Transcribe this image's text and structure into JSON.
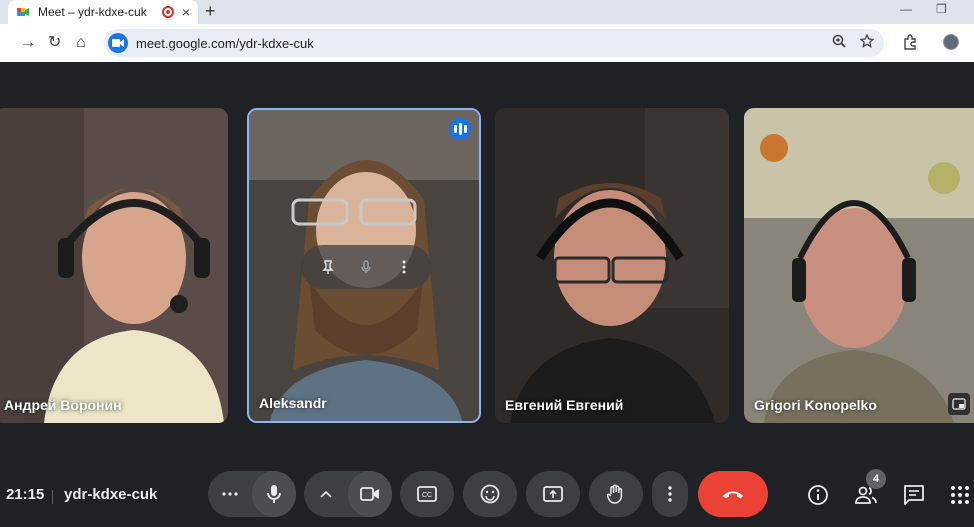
{
  "browser": {
    "tab_title": "Meet – ydr-kdxe-cuk",
    "tab_close": "×",
    "new_tab": "+",
    "minimize": "—",
    "maximize": "❐",
    "back": "→",
    "reload": "↻",
    "home": "⌂",
    "url": "meet.google.com/ydr-kdxe-cuk"
  },
  "participants": [
    {
      "name": "Андрей Воронин",
      "bg": "#5a4c48"
    },
    {
      "name": "Aleksandr",
      "bg": "#4a4440",
      "speaking": true,
      "active": true
    },
    {
      "name": "Евгений Евгений",
      "bg": "#2e2b29"
    },
    {
      "name": "Grigori Konopelko",
      "bg": "#8a857a"
    }
  ],
  "hover_controls": {
    "pin": "pin-icon",
    "mic": "mic-icon",
    "more": "more-vert-icon"
  },
  "bottom": {
    "time": "21:15",
    "meeting_code": "ydr-kdxe-cuk",
    "people_count": "4"
  },
  "colors": {
    "background": "#202124",
    "control": "#3c4043",
    "hangup": "#ea4335",
    "accent": "#8ab4f8"
  }
}
